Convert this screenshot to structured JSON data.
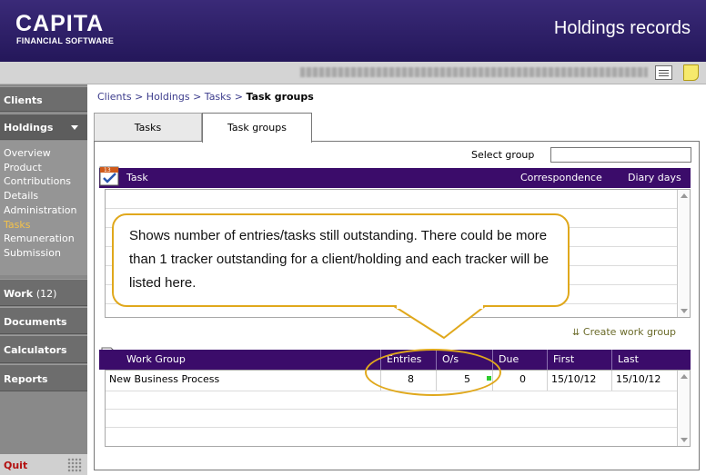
{
  "header": {
    "brand": "CAPITA",
    "brand_sub": "FINANCIAL SOFTWARE",
    "title": "Holdings records"
  },
  "sidebar": {
    "clients": "Clients",
    "holdings": "Holdings",
    "holdings_items": [
      "Overview",
      "Product",
      "Contributions",
      "Details",
      "Administration",
      "Tasks",
      "Remuneration",
      "Submission"
    ],
    "active_item": "Tasks",
    "work": "Work",
    "work_count": "(12)",
    "documents": "Documents",
    "calculators": "Calculators",
    "reports": "Reports",
    "quit": "Quit"
  },
  "breadcrumb": {
    "clients": "Clients",
    "holdings": "Holdings",
    "tasks": "Tasks",
    "current": "Task groups"
  },
  "tabs": [
    "Tasks",
    "Task groups"
  ],
  "select_group": {
    "label": "Select group",
    "value": ""
  },
  "task_table": {
    "headers": {
      "task": "Task",
      "correspondence": "Correspondence",
      "diary_days": "Diary days"
    }
  },
  "create_link": "Create work group",
  "workgroup_table": {
    "headers": [
      "Work Group",
      "Entries",
      "O/s",
      "Due",
      "First",
      "Last"
    ],
    "rows": [
      {
        "work_group": "New Business Process",
        "entries": "8",
        "os": "5",
        "due": "0",
        "first": "15/10/12",
        "last": "15/10/12"
      }
    ]
  },
  "callout": {
    "text": "Shows number of entries/tasks still outstanding. There could be more than 1 tracker outstanding for a client/holding and each tracker will be listed here."
  },
  "colors": {
    "header_bg": "#2e2068",
    "table_header_bg": "#3b0c6a",
    "callout_border": "#e0a81c",
    "active_nav": "#f3c24a",
    "quit": "#b31010"
  }
}
